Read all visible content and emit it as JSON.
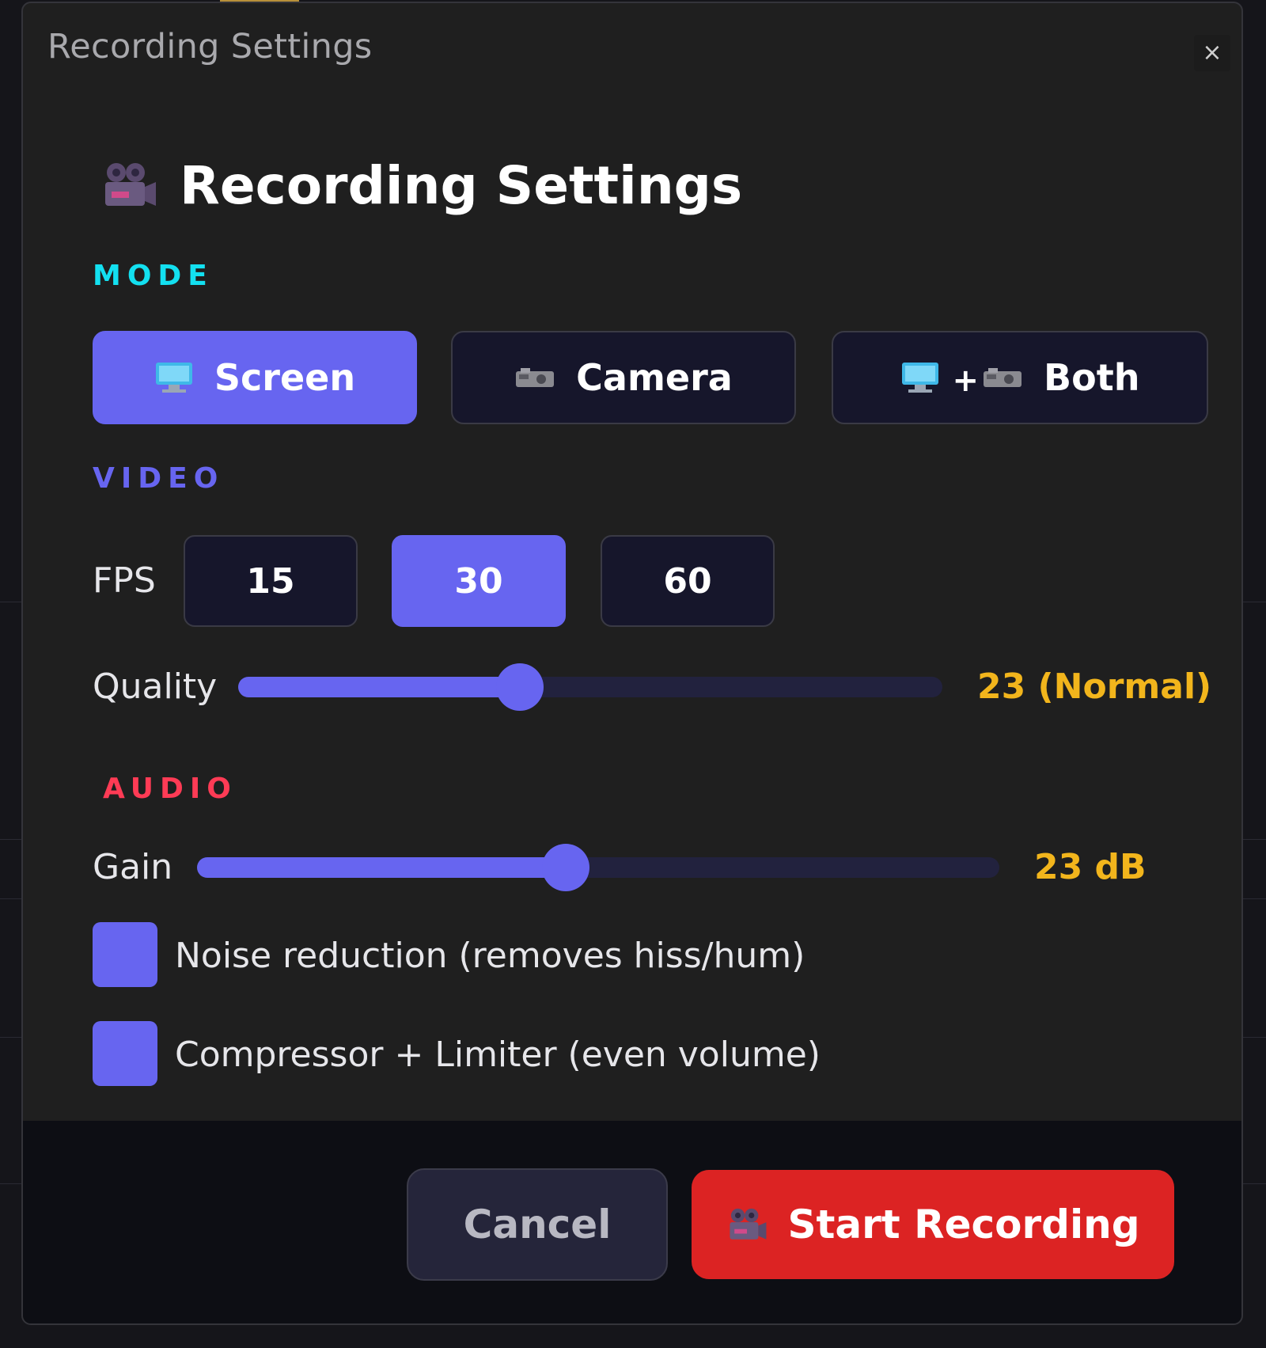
{
  "window": {
    "title": "Recording Settings",
    "close_label": "×"
  },
  "heading": {
    "icon": "film-camera-icon",
    "text": "Recording Settings"
  },
  "colors": {
    "accent": "#6765f0",
    "mode_label": "#13e0f0",
    "video_label": "#6765f0",
    "audio_label": "#ff3b55",
    "value": "#f2b51c",
    "start": "#dc2323"
  },
  "mode": {
    "label": "MODE",
    "options": [
      {
        "label": "Screen",
        "icon": "monitor-icon",
        "selected": true
      },
      {
        "label": "Camera",
        "icon": "camera-icon",
        "selected": false
      },
      {
        "label": "Both",
        "icon": "monitor-plus-camera-icon",
        "plus": "+",
        "selected": false
      }
    ]
  },
  "video": {
    "label": "VIDEO",
    "fps_label": "FPS",
    "fps_options": [
      {
        "label": "15",
        "selected": false
      },
      {
        "label": "30",
        "selected": true
      },
      {
        "label": "60",
        "selected": false
      }
    ],
    "quality_label": "Quality",
    "quality_level": 0.4,
    "quality_value": "23 (Normal)"
  },
  "audio": {
    "label": "AUDIO",
    "gain_label": "Gain",
    "gain_level": 0.46,
    "gain_value": "23 dB",
    "noise_reduction": {
      "label": "Noise reduction (removes hiss/hum)",
      "checked": true
    },
    "compressor": {
      "label": "Compressor + Limiter (even volume)",
      "checked": true
    }
  },
  "footer": {
    "cancel_label": "Cancel",
    "start_label": "Start Recording",
    "start_icon": "film-camera-icon"
  }
}
